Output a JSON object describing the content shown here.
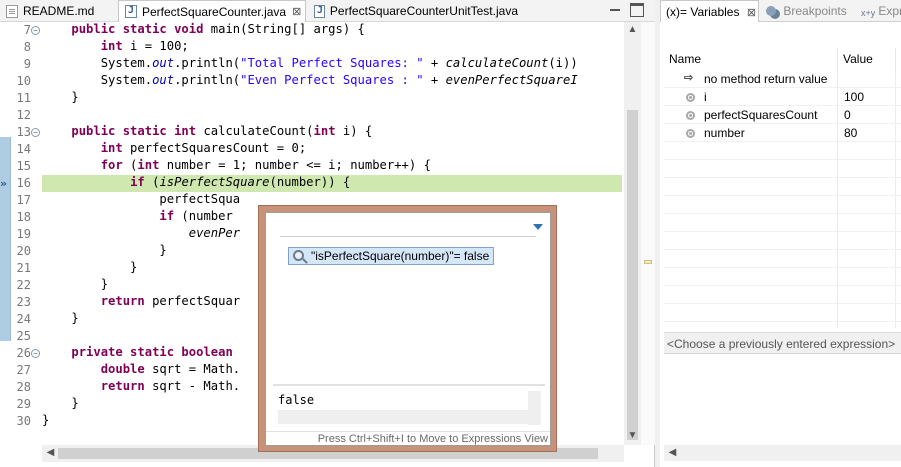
{
  "editor_tabs": [
    {
      "label": "README.md",
      "icon": "md-file-icon"
    },
    {
      "label": "PerfectSquareCounter.java",
      "icon": "java-file-icon",
      "close": "⊠"
    },
    {
      "label": "PerfectSquareCounterUnitTest.java",
      "icon": "java-file-icon"
    }
  ],
  "line_numbers": [
    "7",
    "8",
    "9",
    "10",
    "11",
    "12",
    "13",
    "14",
    "15",
    "16",
    "17",
    "18",
    "19",
    "20",
    "21",
    "22",
    "23",
    "24",
    "25",
    "26",
    "27",
    "28",
    "29",
    "30"
  ],
  "code": [
    [
      {
        "t": "    "
      },
      {
        "t": "public static void",
        "c": "kw"
      },
      {
        "t": " main(String[] args) {"
      }
    ],
    [
      {
        "t": "        "
      },
      {
        "t": "int",
        "c": "kw"
      },
      {
        "t": " i = 100;"
      }
    ],
    [
      {
        "t": "        System."
      },
      {
        "t": "out",
        "c": "fd"
      },
      {
        "t": ".println("
      },
      {
        "t": "\"Total Perfect Squares: \"",
        "c": "st"
      },
      {
        "t": " + "
      },
      {
        "t": "calculateCount",
        "c": "it"
      },
      {
        "t": "(i))"
      }
    ],
    [
      {
        "t": "        System."
      },
      {
        "t": "out",
        "c": "fd"
      },
      {
        "t": ".println("
      },
      {
        "t": "\"Even Perfect Squares : \"",
        "c": "st"
      },
      {
        "t": " + "
      },
      {
        "t": "evenPerfectSquareI",
        "c": "it"
      }
    ],
    [
      {
        "t": "    }"
      }
    ],
    [
      {
        "t": ""
      }
    ],
    [
      {
        "t": "    "
      },
      {
        "t": "public static int",
        "c": "kw"
      },
      {
        "t": " calculateCount("
      },
      {
        "t": "int",
        "c": "kw"
      },
      {
        "t": " i) {"
      }
    ],
    [
      {
        "t": "        "
      },
      {
        "t": "int",
        "c": "kw"
      },
      {
        "t": " perfectSquaresCount = 0;"
      }
    ],
    [
      {
        "t": "        "
      },
      {
        "t": "for",
        "c": "kw"
      },
      {
        "t": " ("
      },
      {
        "t": "int",
        "c": "kw"
      },
      {
        "t": " number = 1; number <= i; number++) {"
      }
    ],
    [
      {
        "t": "            "
      },
      {
        "t": "if",
        "c": "kw"
      },
      {
        "t": " ("
      },
      {
        "t": "isPerfectSquare",
        "c": "it"
      },
      {
        "t": "(number)) {"
      }
    ],
    [
      {
        "t": "                perfectSqua"
      }
    ],
    [
      {
        "t": "                "
      },
      {
        "t": "if",
        "c": "kw"
      },
      {
        "t": " (number"
      }
    ],
    [
      {
        "t": "                    "
      },
      {
        "t": "evenPer",
        "c": "it"
      }
    ],
    [
      {
        "t": "                }"
      }
    ],
    [
      {
        "t": "            }"
      }
    ],
    [
      {
        "t": "        }"
      }
    ],
    [
      {
        "t": "        "
      },
      {
        "t": "return",
        "c": "kw"
      },
      {
        "t": " perfectSquar"
      }
    ],
    [
      {
        "t": "    }"
      }
    ],
    [
      {
        "t": ""
      }
    ],
    [
      {
        "t": "    "
      },
      {
        "t": "private static boolean",
        "c": "kw"
      }
    ],
    [
      {
        "t": "        "
      },
      {
        "t": "double",
        "c": "kw"
      },
      {
        "t": " sqrt = Math."
      }
    ],
    [
      {
        "t": "        "
      },
      {
        "t": "return",
        "c": "kw"
      },
      {
        "t": " sqrt - Math."
      }
    ],
    [
      {
        "t": "    }"
      }
    ],
    [
      {
        "t": "}"
      }
    ]
  ],
  "hover": {
    "expression_label": "\"isPerfectSquare(number)\"= false",
    "value": "false",
    "footer": "Press Ctrl+Shift+I to Move to Expressions View"
  },
  "side_tabs": {
    "variables": "(x)= Variables",
    "variables_close": "⊠",
    "breakpoints": "Breakpoints",
    "expressions": "Expre"
  },
  "variables": {
    "columns": [
      "Name",
      "Value"
    ],
    "rows": [
      {
        "name": "no method return value",
        "value": "",
        "icon": "return-icon"
      },
      {
        "name": "i",
        "value": "100",
        "icon": "local-variable-icon"
      },
      {
        "name": "perfectSquaresCount",
        "value": "0",
        "icon": "local-variable-icon"
      },
      {
        "name": "number",
        "value": "80",
        "icon": "local-variable-icon"
      }
    ],
    "expression_prompt": "<Choose a previously entered expression>"
  },
  "colors": {
    "current_line": "#cfe8b0",
    "keyword": "#7f0055",
    "string": "#2a00ff",
    "hover_border": "#c6927a"
  }
}
